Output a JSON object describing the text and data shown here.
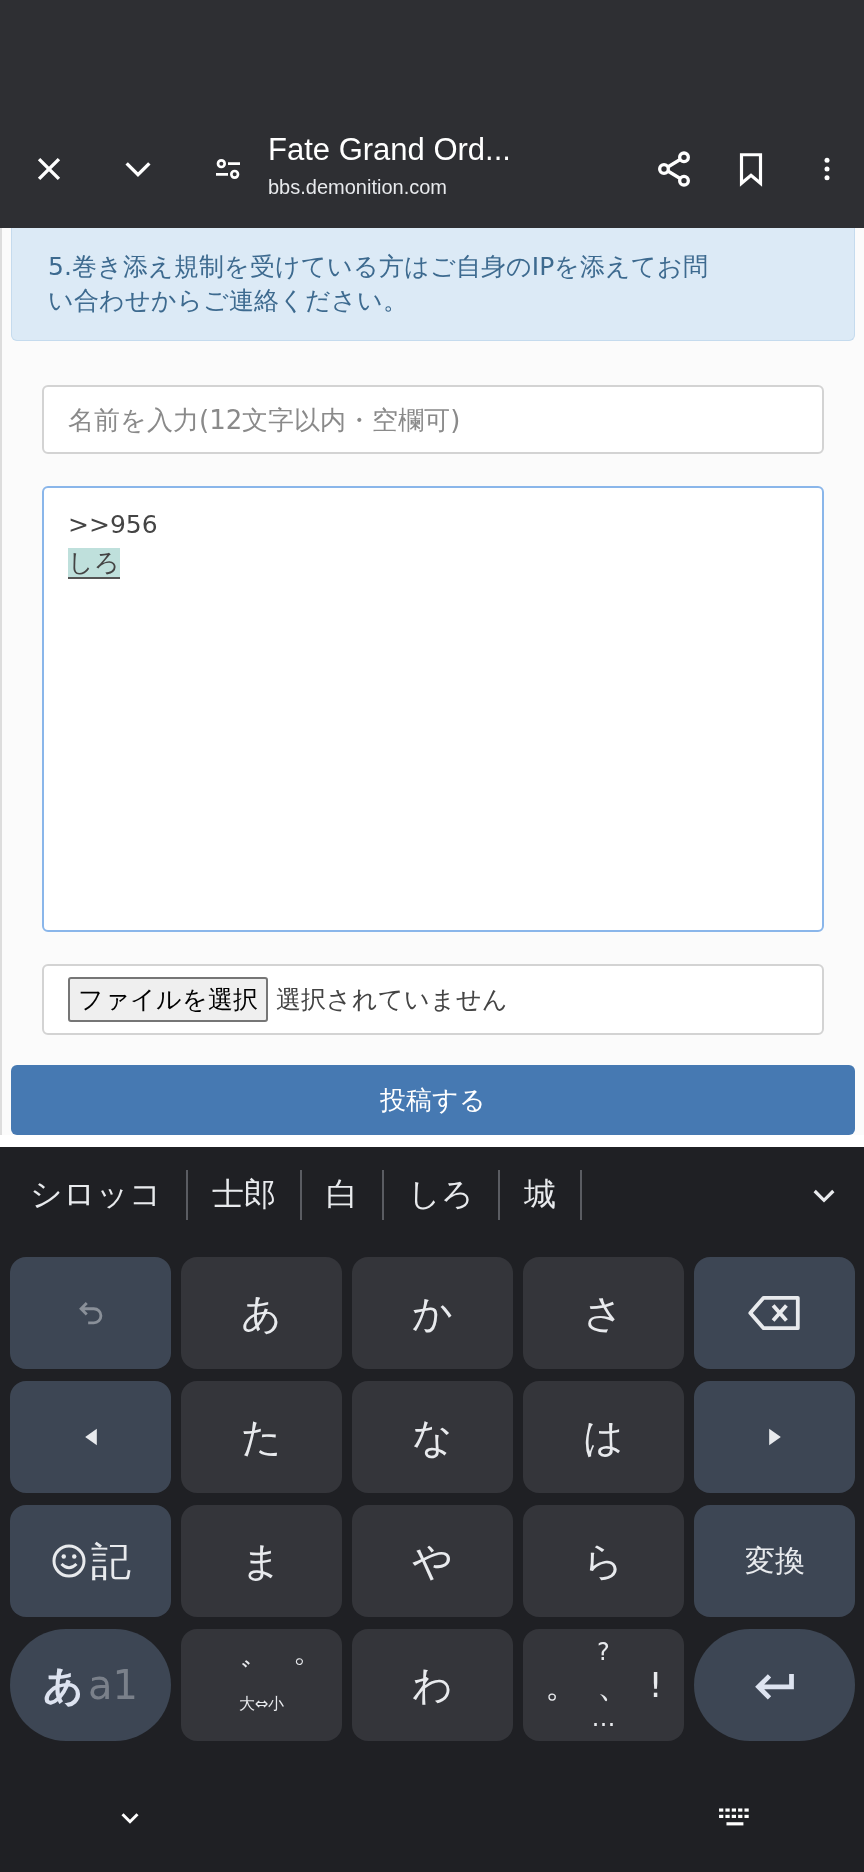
{
  "browser_bar": {
    "title": "Fate Grand Ord...",
    "url": "bbs.demonition.com"
  },
  "notice": {
    "lines": [
      "5.巻き添え規制を受けている方はご自身のIPを添えてお問",
      "い合わせからご連絡ください。"
    ]
  },
  "form": {
    "name_field": {
      "placeholder": "名前を入力(12文字以内・空欄可)"
    },
    "message_field": {
      "value": ">>956",
      "composing": "しろ"
    },
    "file_input": {
      "button": "ファイルを選択",
      "status": "選択されていません"
    },
    "submit_button": "投稿する"
  },
  "keyboard": {
    "candidates": [
      "シロッコ",
      "士郎",
      "白",
      "しろ",
      "城"
    ],
    "rows": [
      [
        {
          "kind": "undo"
        },
        {
          "kind": "text",
          "label": "あ"
        },
        {
          "kind": "text",
          "label": "か"
        },
        {
          "kind": "text",
          "label": "さ"
        },
        {
          "kind": "backspace"
        }
      ],
      [
        {
          "kind": "left"
        },
        {
          "kind": "text",
          "label": "た"
        },
        {
          "kind": "text",
          "label": "な"
        },
        {
          "kind": "text",
          "label": "は"
        },
        {
          "kind": "right"
        }
      ],
      [
        {
          "kind": "emoji",
          "label": "記"
        },
        {
          "kind": "text",
          "label": "ま"
        },
        {
          "kind": "text",
          "label": "や"
        },
        {
          "kind": "text",
          "label": "ら"
        },
        {
          "kind": "small",
          "label": "変換"
        }
      ],
      [
        {
          "kind": "mode",
          "label": "あ",
          "sub": "a1"
        },
        {
          "kind": "dakuten",
          "marks": [
            "゛",
            "゜"
          ],
          "sub": "大⇔小"
        },
        {
          "kind": "text",
          "label": "わ"
        },
        {
          "kind": "punct",
          "top": "?",
          "marks": [
            "。",
            "、",
            "!"
          ],
          "bottom": "…"
        },
        {
          "kind": "enter"
        }
      ]
    ]
  }
}
